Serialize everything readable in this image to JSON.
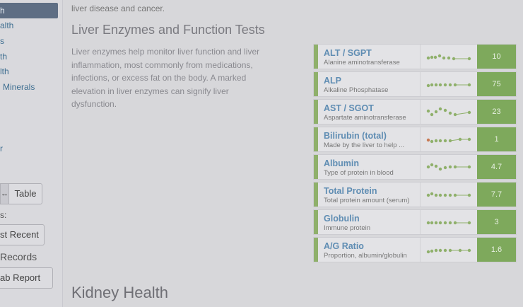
{
  "sidebar": {
    "active_item": "h",
    "items": [
      "alth",
      "s",
      "th",
      "lth",
      "Minerals",
      "r"
    ],
    "view_toggle_left": "↔",
    "view_toggle_right": "Table",
    "sort_label": "s:",
    "sort_button": "st Recent",
    "records_label": "Records",
    "lab_report_button": "ab Report"
  },
  "main": {
    "intro_text": "liver disease and cancer.",
    "section_title": "Liver Enzymes and Function Tests",
    "section_desc": "Liver enzymes help monitor liver function and liver inflammation, most commonly from medications, infections, or excess fat on the body. A marked elevation in liver enzymes can signify liver dysfunction.",
    "next_section_title": "Kidney Health",
    "tests": [
      {
        "name": "ALT / SGPT",
        "desc": "Alanine aminotransferase",
        "value": "10"
      },
      {
        "name": "ALP",
        "desc": "Alkaline Phosphatase",
        "value": "75"
      },
      {
        "name": "AST / SGOT",
        "desc": "Aspartate aminotransferase",
        "value": "23"
      },
      {
        "name": "Bilirubin (total)",
        "desc": "Made by the liver to help ...",
        "value": "1"
      },
      {
        "name": "Albumin",
        "desc": "Type of protein in blood",
        "value": "4.7"
      },
      {
        "name": "Total Protein",
        "desc": "Total protein amount (serum)",
        "value": "7.7"
      },
      {
        "name": "Globulin",
        "desc": "Immune protein",
        "value": "3"
      },
      {
        "name": "A/G Ratio",
        "desc": "Proportion, albumin/globulin",
        "value": "1.6"
      }
    ],
    "colors": {
      "accent_green": "#7ea95c",
      "link_blue": "#5f8db3"
    }
  }
}
